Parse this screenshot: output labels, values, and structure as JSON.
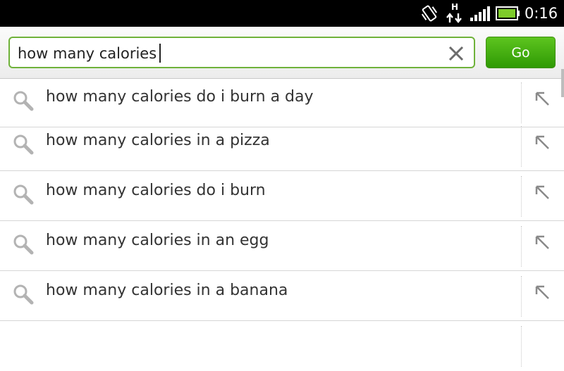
{
  "status_bar": {
    "time": "0:16",
    "network_type": "H",
    "icons": [
      "vibrate-icon",
      "data-arrows-icon",
      "signal-icon",
      "battery-icon"
    ]
  },
  "search": {
    "query": "how many calories",
    "go_label": "Go",
    "accent_color": "#5dc51f"
  },
  "suggestions": [
    {
      "text": "how many calories do i burn a day"
    },
    {
      "text": "how many calories in a pizza"
    },
    {
      "text": "how many calories do i burn"
    },
    {
      "text": "how many calories in an egg"
    },
    {
      "text": "how many calories in a banana"
    }
  ]
}
